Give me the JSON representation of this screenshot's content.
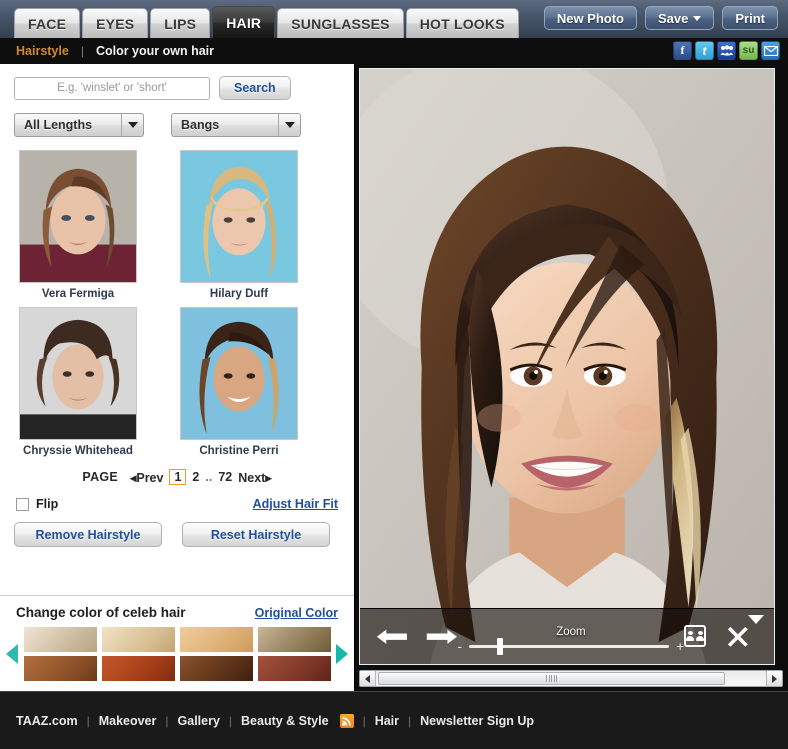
{
  "header": {
    "tabs": [
      {
        "label": "FACE",
        "active": false
      },
      {
        "label": "EYES",
        "active": false
      },
      {
        "label": "LIPS",
        "active": false
      },
      {
        "label": "HAIR",
        "active": true
      },
      {
        "label": "SUNGLASSES",
        "active": false
      },
      {
        "label": "HOT LOOKS",
        "active": false
      }
    ],
    "actions": {
      "new_photo": "New Photo",
      "save": "Save",
      "print": "Print"
    }
  },
  "subnav": {
    "breadcrumb_active": "Hairstyle",
    "separator": "|",
    "breadcrumb_link": "Color your own hair",
    "social": [
      {
        "name": "facebook-icon",
        "glyph": "f"
      },
      {
        "name": "twitter-icon",
        "glyph": "t"
      },
      {
        "name": "myspace-icon",
        "glyph": "ම"
      },
      {
        "name": "stumbleupon-icon",
        "glyph": "su"
      },
      {
        "name": "email-icon",
        "glyph": "✉"
      }
    ]
  },
  "sidebar": {
    "search": {
      "placeholder": "E.g. 'winslet' or 'short'",
      "value": "",
      "button_label": "Search"
    },
    "filters": [
      {
        "name": "length-filter",
        "value": "All Lengths"
      },
      {
        "name": "bangs-filter",
        "value": "Bangs"
      }
    ],
    "hairstyles": [
      {
        "name": "Vera Fermiga",
        "bg": "#b7b2aa",
        "hair": "#6f4a33",
        "hair2": "#8a5c3d",
        "skin": "#e8c3a8"
      },
      {
        "name": "Hilary Duff",
        "bg": "#79c8e0",
        "hair": "#d6b27a",
        "hair2": "#e8cf9e",
        "skin": "#ecc7ad"
      },
      {
        "name": "Chryssie Whitehead",
        "bg": "#d7d7d7",
        "hair": "#3d2a20",
        "hair2": "#5b3e2c",
        "skin": "#e3bfa5"
      },
      {
        "name": "Christine Perri",
        "bg": "#7ec0dd",
        "hair": "#3a2418",
        "hair2": "#6d4426",
        "skin": "#d8a681"
      }
    ],
    "pagination": {
      "label": "PAGE",
      "prev": "Prev",
      "next": "Next",
      "pages": [
        "1",
        "2"
      ],
      "ellipsis": "..",
      "last": "72",
      "current": "1"
    },
    "flip_label": "Flip",
    "flip_checked": false,
    "adjust_hair_fit": "Adjust Hair Fit",
    "remove_hairstyle": "Remove Hairstyle",
    "reset_hairstyle": "Reset Hairstyle",
    "color_section": {
      "title": "Change color of celeb hair",
      "original_color_link": "Original Color",
      "swatches": [
        {
          "id": "swatch-1",
          "c1": "#efe6d7",
          "c2": "#cdbda2",
          "c3": "#b7a484"
        },
        {
          "id": "swatch-2",
          "c1": "#f2e2c6",
          "c2": "#d8bd93",
          "c3": "#c2a272"
        },
        {
          "id": "swatch-3",
          "c1": "#f0cb9c",
          "c2": "#dcae74",
          "c3": "#cf9b5b"
        },
        {
          "id": "swatch-4",
          "c1": "#c9b894",
          "c2": "#8e7a55",
          "c3": "#6e5c3d"
        },
        {
          "id": "swatch-5",
          "c1": "#b4703e",
          "c2": "#8a4f28",
          "c3": "#6b3a1b"
        },
        {
          "id": "swatch-6",
          "c1": "#c4572a",
          "c2": "#a03c18",
          "c3": "#7d2d10"
        },
        {
          "id": "swatch-7",
          "c1": "#8a5330",
          "c2": "#5b3118",
          "c3": "#3e200f"
        },
        {
          "id": "swatch-8",
          "c1": "#a5503c",
          "c2": "#7c3526",
          "c3": "#5c2419"
        }
      ],
      "prev_arrow": "scroll-left",
      "next_arrow": "scroll-right"
    }
  },
  "viewer": {
    "overlay": {
      "zoom_label": "Zoom",
      "zoom_minus": "-",
      "zoom_plus": "+",
      "prev_icon": "arrow-left",
      "next_icon": "arrow-right",
      "before_after_icon": "before-after",
      "close_icon": "close",
      "collapse_icon": "collapse"
    },
    "scrollbar": {
      "left_arrow": "◀",
      "right_arrow": "▶"
    }
  },
  "footer": {
    "links": [
      "TAAZ.com",
      "Makeover",
      "Gallery",
      "Beauty & Style",
      "Hair",
      "Newsletter Sign Up"
    ],
    "separator": "|",
    "rss_label": "rss-feed"
  }
}
